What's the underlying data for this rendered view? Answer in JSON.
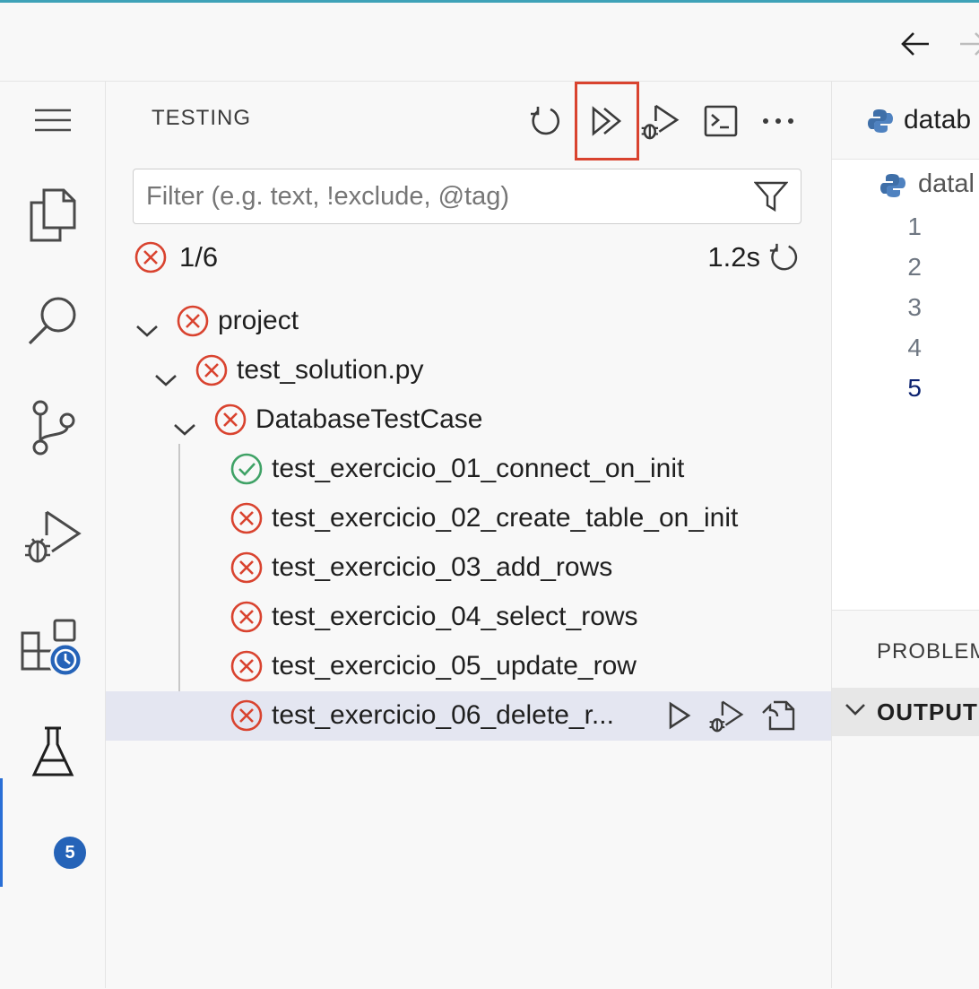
{
  "colors": {
    "accent": "#2a6fd6",
    "error": "#d9432f",
    "pass": "#3fa266",
    "highlight": "#d9432f",
    "badge": "#2563b8"
  },
  "titlebar": {
    "back_icon": "arrow-left-icon",
    "forward_icon": "arrow-right-icon"
  },
  "activity_bar": {
    "items": [
      {
        "name": "menu",
        "icon": "hamburger-menu-icon"
      },
      {
        "name": "explorer",
        "icon": "files-icon"
      },
      {
        "name": "search",
        "icon": "search-icon"
      },
      {
        "name": "source-control",
        "icon": "source-control-icon"
      },
      {
        "name": "run-and-debug",
        "icon": "debug-run-icon"
      },
      {
        "name": "extensions",
        "icon": "extensions-icon"
      },
      {
        "name": "testing",
        "icon": "beaker-icon",
        "active": true
      }
    ],
    "testing_badge": "5"
  },
  "sidebar": {
    "title": "TESTING",
    "toolbar": [
      {
        "name": "refresh-tests",
        "icon": "refresh-icon"
      },
      {
        "name": "run-all-tests",
        "icon": "run-all-icon",
        "highlighted": true
      },
      {
        "name": "debug-all-tests",
        "icon": "debug-run-icon"
      },
      {
        "name": "show-output",
        "icon": "terminal-icon"
      },
      {
        "name": "more-actions",
        "icon": "ellipsis-icon"
      }
    ],
    "filter": {
      "placeholder": "Filter (e.g. text, !exclude, @tag)",
      "value": ""
    },
    "summary": {
      "count": "1/6",
      "duration": "1.2s"
    },
    "tree": [
      {
        "label": "project",
        "status": "failed",
        "expanded": true,
        "depth": 0
      },
      {
        "label": "test_solution.py",
        "status": "failed",
        "expanded": true,
        "depth": 1
      },
      {
        "label": "DatabaseTestCase",
        "status": "failed",
        "expanded": true,
        "depth": 2
      },
      {
        "label": "test_exercicio_01_connect_on_init",
        "status": "passed",
        "depth": 3
      },
      {
        "label": "test_exercicio_02_create_table_on_init",
        "status": "failed",
        "depth": 3
      },
      {
        "label": "test_exercicio_03_add_rows",
        "status": "failed",
        "depth": 3
      },
      {
        "label": "test_exercicio_04_select_rows",
        "status": "failed",
        "depth": 3
      },
      {
        "label": "test_exercicio_05_update_row",
        "status": "failed",
        "depth": 3
      },
      {
        "label": "test_exercicio_06_delete_r...",
        "status": "failed",
        "depth": 3,
        "selected": true
      }
    ],
    "row_actions": [
      {
        "name": "run-test",
        "icon": "play-icon"
      },
      {
        "name": "debug-test",
        "icon": "debug-run-icon"
      },
      {
        "name": "go-to-test",
        "icon": "go-to-file-icon"
      }
    ]
  },
  "editor": {
    "tab_label": "datab",
    "breadcrumb": "datal",
    "line_numbers": [
      "1",
      "2",
      "3",
      "4",
      "5"
    ],
    "active_line": "5"
  },
  "panel": {
    "tab": "PROBLEM",
    "section": "OUTPUT"
  }
}
